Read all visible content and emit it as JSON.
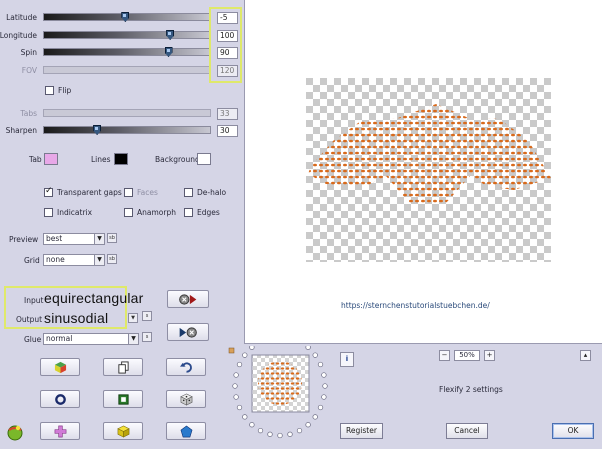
{
  "sliders": {
    "latitude": {
      "label": "Latitude",
      "value": "-5",
      "level": 0.49
    },
    "longitude": {
      "label": "Longitude",
      "value": "100",
      "level": 0.76
    },
    "spin": {
      "label": "Spin",
      "value": "90",
      "level": 0.75
    },
    "fov": {
      "label": "FOV",
      "value": "120"
    },
    "tabs": {
      "label": "Tabs",
      "value": "33"
    },
    "sharpen": {
      "label": "Sharpen",
      "value": "30",
      "level": 0.32
    }
  },
  "annotations": {
    "latitude": "-5",
    "longitude": "100",
    "spin": "90",
    "fov": "120",
    "input": "equirectangular",
    "output": "sinusodial"
  },
  "flip_label": "Flip",
  "colors": {
    "tab_label": "Tab",
    "lines_label": "Lines",
    "background_label": "Background",
    "tab_color": "#e8a8e8",
    "lines_color": "#000000",
    "background_color": "#ffffff",
    "dot_color": "#d86a1c",
    "highlight": "#dfe96a"
  },
  "checkboxes": {
    "transparent_gaps": "Transparent gaps",
    "faces": "Faces",
    "de_halo": "De-halo",
    "indicatrix": "Indicatrix",
    "anamorph": "Anamorph",
    "edges": "Edges"
  },
  "preview": {
    "label": "Preview",
    "value": "best",
    "button": "sb"
  },
  "grid": {
    "label": "Grid",
    "value": "none",
    "button": "sb"
  },
  "io": {
    "input_label": "Input",
    "output_label": "Output",
    "glue_label": "Glue",
    "glue_value": "normal",
    "s_button": "s"
  },
  "preview_url": "https://sternchenstutorialstuebchen.de/",
  "zoom": {
    "minus": "−",
    "value": "50%",
    "plus": "+"
  },
  "info_icon": "i",
  "settings_text": "Flexify 2 settings",
  "buttons": {
    "register": "Register",
    "cancel": "Cancel",
    "ok": "OK",
    "scroll_up": "▴"
  }
}
